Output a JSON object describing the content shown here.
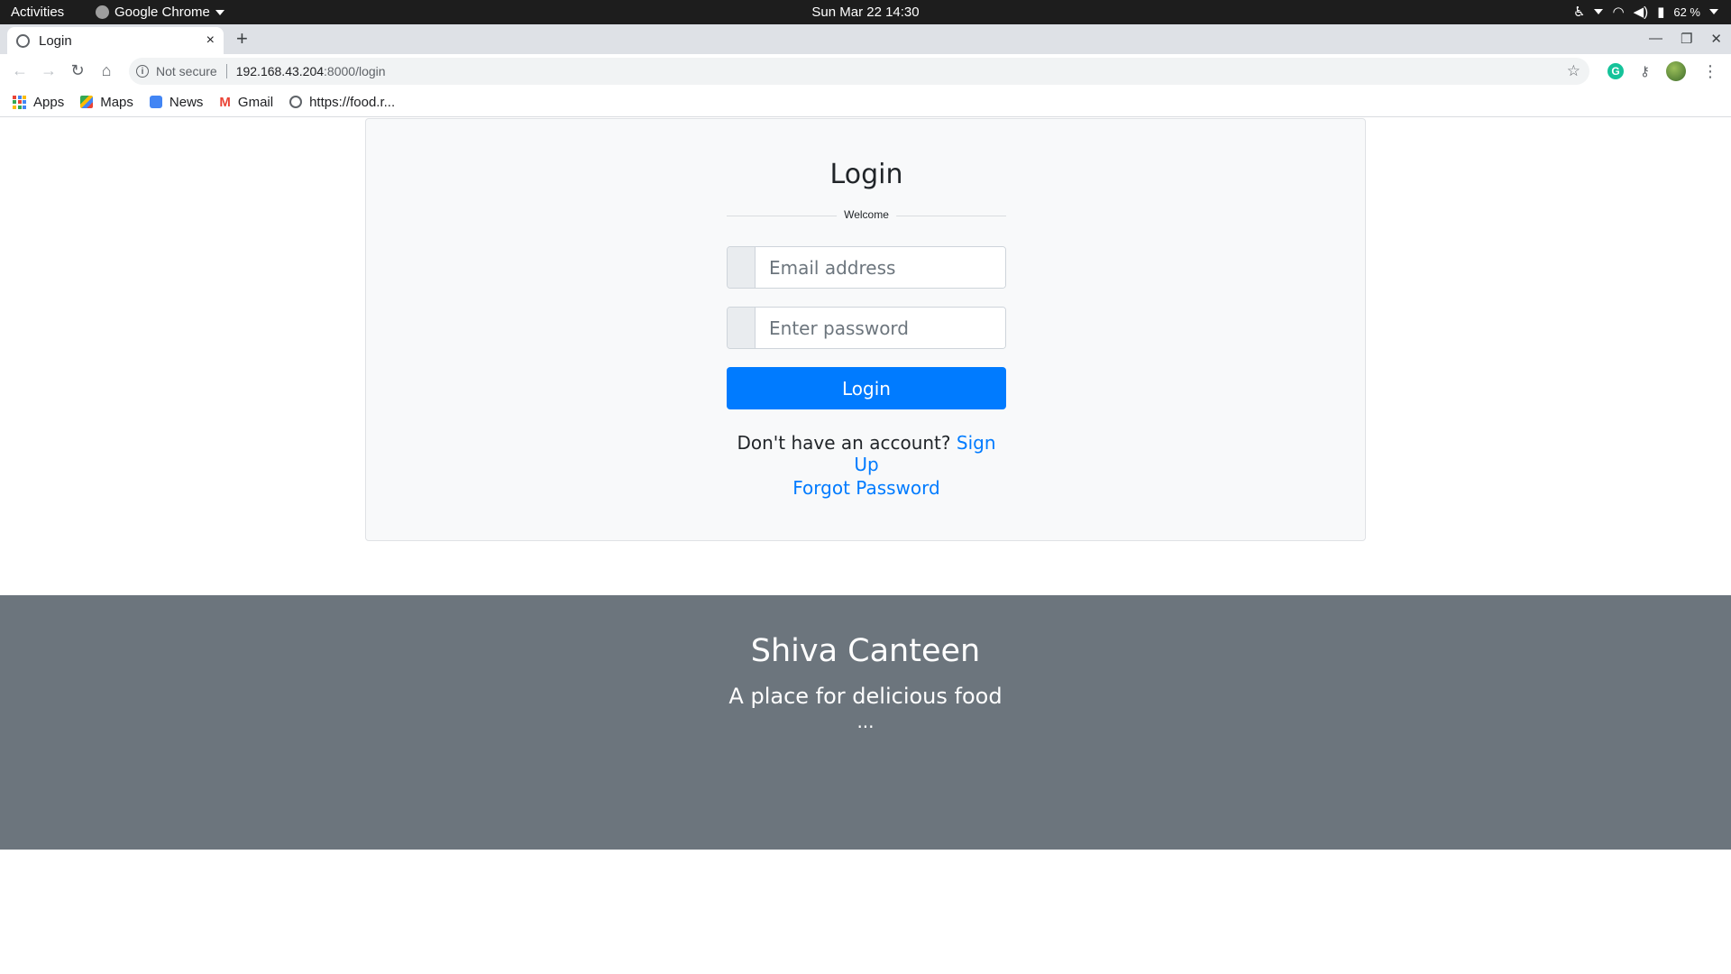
{
  "system_bar": {
    "activities": "Activities",
    "app_name": "Google Chrome",
    "clock": "Sun Mar 22  14:30",
    "battery": "62 %"
  },
  "browser": {
    "tab_title": "Login",
    "tab_close": "×",
    "new_tab": "+",
    "address": {
      "security_label": "Not secure",
      "host": "192.168.43.204",
      "path": ":8000/login"
    },
    "bookmarks": [
      {
        "label": "Apps",
        "icon": "apps-grid-icon"
      },
      {
        "label": "Maps",
        "icon": "maps-icon"
      },
      {
        "label": "News",
        "icon": "news-icon"
      },
      {
        "label": "Gmail",
        "icon": "gmail-icon"
      },
      {
        "label": "https://food.r...",
        "icon": "globe-icon"
      }
    ]
  },
  "login": {
    "title": "Login",
    "divider_label": "Welcome",
    "email_placeholder": "Email address",
    "password_placeholder": "Enter password",
    "submit_label": "Login",
    "signup_prompt": "Don't have an account?",
    "signup_link": "Sign Up",
    "forgot_link": "Forgot Password"
  },
  "footer": {
    "brand": "Shiva Canteen",
    "tagline": "A place for delicious food",
    "ellipsis": "..."
  },
  "colors": {
    "primary": "#007bff",
    "footer_bg": "#6c757d",
    "card_bg": "#f8f9fa"
  }
}
